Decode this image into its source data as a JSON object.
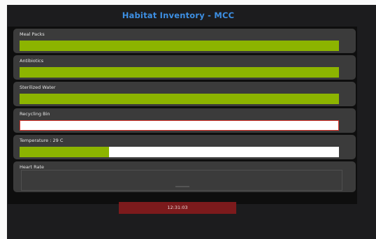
{
  "header": {
    "title": "Habitat Inventory - MCC"
  },
  "inventory": {
    "meal_packs": {
      "label": "Meal Packs",
      "level": 1.0
    },
    "antibiotics": {
      "label": "Antibiotics",
      "level": 1.0
    },
    "sterilized_water": {
      "label": "Sterilized Water",
      "level": 1.0
    },
    "recycling_bin": {
      "label": "Recycling Bin",
      "level": 0.0
    },
    "temperature": {
      "label": "Temperature : 29 C",
      "level": 0.28
    }
  },
  "heart_rate": {
    "label": "Heart Rate"
  },
  "footer": {
    "clock": "12:31:03"
  },
  "colors": {
    "title": "#3d8fe3",
    "bar_fill": "#8cb400",
    "bar_empty": "#ffffff",
    "alert_border": "#d9342b",
    "clock_bg": "#7c1a1c"
  }
}
